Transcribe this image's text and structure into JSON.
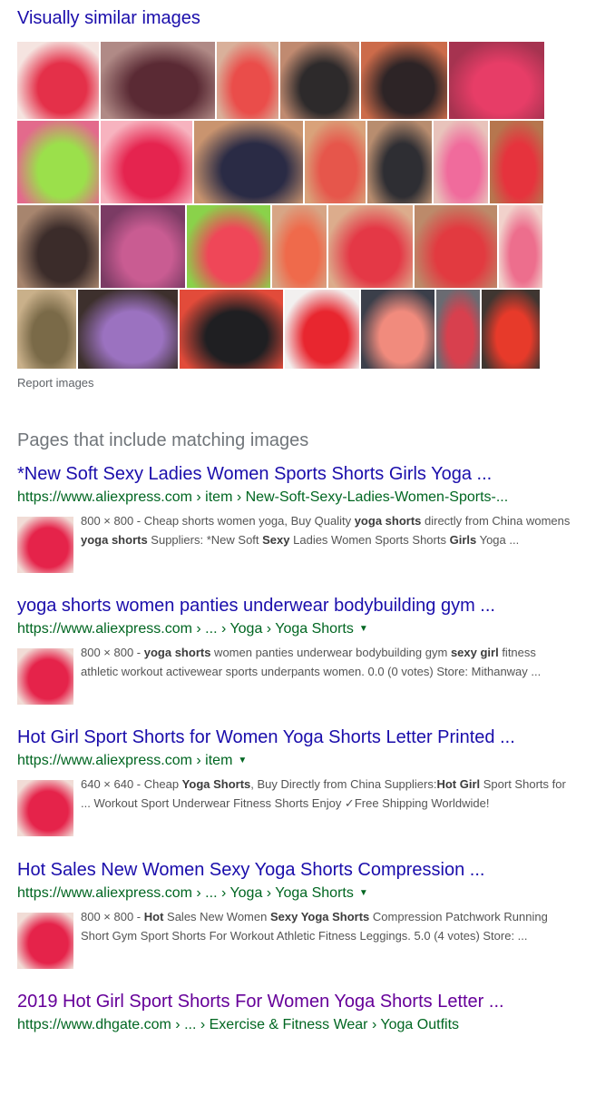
{
  "similar": {
    "title": "Visually similar images",
    "report": "Report images",
    "rows": [
      [
        {
          "name": "thumb-1-1",
          "c1": "#e43049",
          "c2": "#f5e4e0"
        },
        {
          "name": "thumb-1-2",
          "c1": "#5a2a34",
          "c2": "#b08a86"
        },
        {
          "name": "thumb-1-3",
          "c1": "#ea4d4a",
          "c2": "#d9b09a"
        },
        {
          "name": "thumb-1-4",
          "c1": "#2d2a2b",
          "c2": "#c08a70"
        },
        {
          "name": "thumb-1-5",
          "c1": "#2d2426",
          "c2": "#cc6b4a"
        },
        {
          "name": "thumb-1-6",
          "c1": "#e73d67",
          "c2": "#a63350"
        }
      ],
      [
        {
          "name": "thumb-2-1",
          "c1": "#9be04b",
          "c2": "#e36a8c"
        },
        {
          "name": "thumb-2-2",
          "c1": "#e5244f",
          "c2": "#f7b3bf"
        },
        {
          "name": "thumb-2-3",
          "c1": "#2a2b45",
          "c2": "#c9946f"
        },
        {
          "name": "thumb-2-4",
          "c1": "#e6564b",
          "c2": "#d9a27a"
        },
        {
          "name": "thumb-2-5",
          "c1": "#2e2e33",
          "c2": "#b88d6f"
        },
        {
          "name": "thumb-2-6",
          "c1": "#f06b9c",
          "c2": "#e8c3bb"
        },
        {
          "name": "thumb-2-7",
          "c1": "#e6333d",
          "c2": "#b6764e"
        }
      ],
      [
        {
          "name": "thumb-3-1",
          "c1": "#3b2c2a",
          "c2": "#a7856e"
        },
        {
          "name": "thumb-3-2",
          "c1": "#c95c92",
          "c2": "#7b3b64"
        },
        {
          "name": "thumb-3-3",
          "c1": "#ef4758",
          "c2": "#8ad24a"
        },
        {
          "name": "thumb-3-4",
          "c1": "#ef6a4b",
          "c2": "#d7a585"
        },
        {
          "name": "thumb-3-5",
          "c1": "#e43846",
          "c2": "#dcac8c"
        },
        {
          "name": "thumb-3-6",
          "c1": "#e23a40",
          "c2": "#bc8a6a"
        },
        {
          "name": "thumb-3-7",
          "c1": "#ed6e8d",
          "c2": "#f1d1cb"
        }
      ],
      [
        {
          "name": "thumb-4-1",
          "c1": "#7a6a48",
          "c2": "#c9b08a"
        },
        {
          "name": "thumb-4-2",
          "c1": "#9b72c0",
          "c2": "#3d302d"
        },
        {
          "name": "thumb-4-3",
          "c1": "#1f1f22",
          "c2": "#e24b3a"
        },
        {
          "name": "thumb-4-4",
          "c1": "#e8262f",
          "c2": "#f2f0ef"
        },
        {
          "name": "thumb-4-5",
          "c1": "#f18b7d",
          "c2": "#3b3f4a"
        },
        {
          "name": "thumb-4-6",
          "c1": "#d8404e",
          "c2": "#6a6b72"
        },
        {
          "name": "thumb-4-7",
          "c1": "#e73a2a",
          "c2": "#3f3631"
        }
      ]
    ]
  },
  "pages": {
    "title": "Pages that include matching images",
    "results": [
      {
        "title": "*New Soft Sexy Ladies Women Sports Shorts Girls Yoga ...",
        "url": "https://www.aliexpress.com › item › New-Soft-Sexy-Ladies-Women-Sports-...",
        "has_caret": false,
        "visited": false,
        "snippet_html": "800 × 800 - Cheap shorts women yoga, Buy Quality <b>yoga shorts</b> directly from China womens <b>yoga shorts</b> Suppliers: *New Soft <b>Sexy</b> Ladies Women Sports Shorts <b>Girls</b> Yoga ..."
      },
      {
        "title": "yoga shorts women panties underwear bodybuilding gym ...",
        "url": "https://www.aliexpress.com › ... › Yoga › Yoga Shorts",
        "has_caret": true,
        "visited": false,
        "snippet_html": "800 × 800 - <b>yoga shorts</b> women panties underwear bodybuilding gym <b>sexy girl</b> fitness athletic workout activewear sports underpants women. 0.0 (0 votes) Store: Mithanway ..."
      },
      {
        "title": "Hot Girl Sport Shorts for Women Yoga Shorts Letter Printed ...",
        "url": "https://www.aliexpress.com › item",
        "has_caret": true,
        "visited": false,
        "snippet_html": "640 × 640 - Cheap <b>Yoga Shorts</b>, Buy Directly from China Suppliers:<b>Hot Girl</b> Sport Shorts for ... Workout Sport Underwear Fitness Shorts Enjoy ✓Free Shipping Worldwide!"
      },
      {
        "title": "Hot Sales New Women Sexy Yoga Shorts Compression ...",
        "url": "https://www.aliexpress.com › ... › Yoga › Yoga Shorts",
        "has_caret": true,
        "visited": false,
        "snippet_html": "800 × 800 - <b>Hot</b> Sales New Women <b>Sexy Yoga Shorts</b> Compression Patchwork Running Short Gym Sport Shorts For Workout Athletic Fitness Leggings. 5.0 (4 votes) Store: ..."
      },
      {
        "title": "2019 Hot Girl Sport Shorts For Women Yoga Shorts Letter ...",
        "url": "https://www.dhgate.com › ... › Exercise & Fitness Wear › Yoga Outfits",
        "has_caret": false,
        "visited": true,
        "snippet_html": ""
      }
    ]
  },
  "colors": {
    "link": "#1a0dab",
    "visited": "#660099",
    "url": "#006621",
    "snippet": "#545454"
  }
}
